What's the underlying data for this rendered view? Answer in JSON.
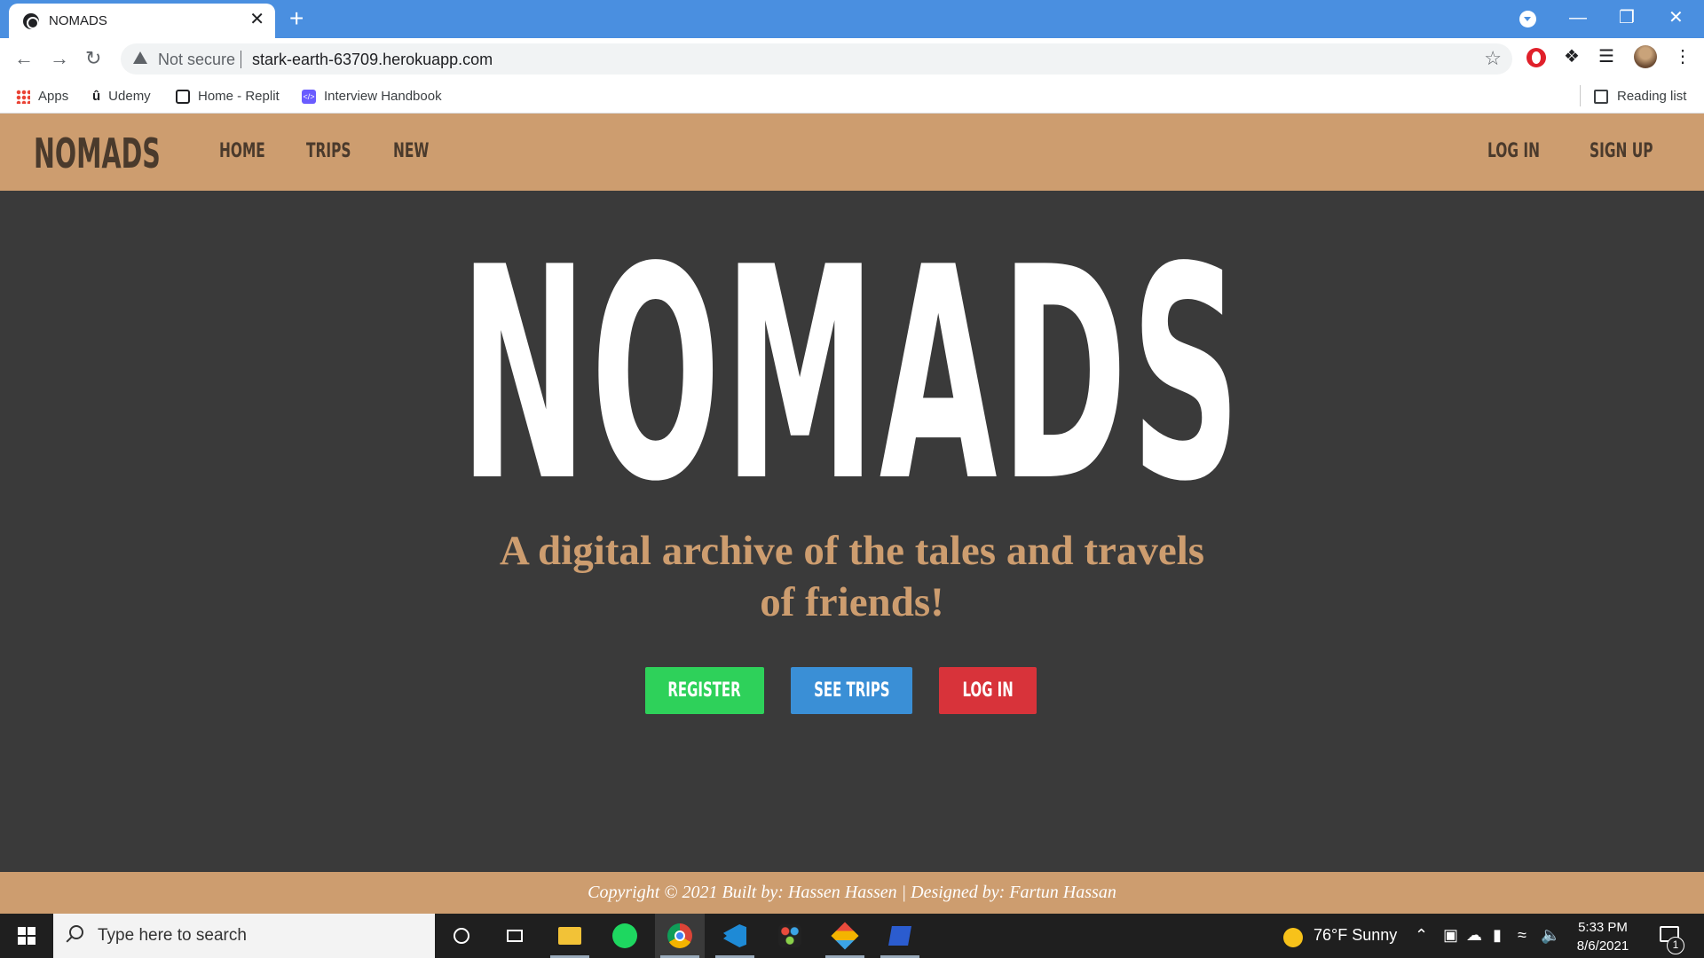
{
  "browser": {
    "tab_title": "NOMADS",
    "tab_close": "✕",
    "new_tab": "+",
    "security_label": "Not secure",
    "url": "stark-earth-63709.herokuapp.com",
    "window_controls": [
      "—",
      "❐",
      "✕"
    ],
    "icons": [
      "globe-icon",
      "back-arrow-icon",
      "forward-arrow-icon",
      "reload-icon",
      "warning-icon",
      "star-icon",
      "opera-icon",
      "puzzle-icon",
      "media-icon",
      "profile-avatar",
      "menu-dots-icon"
    ]
  },
  "bookmarks": {
    "items": [
      {
        "label": "Apps"
      },
      {
        "label": "Udemy"
      },
      {
        "label": "Home - Replit"
      },
      {
        "label": "Interview Handbook"
      }
    ],
    "reading_list": "Reading list"
  },
  "site": {
    "brand": "NOMADS",
    "nav": [
      {
        "label": "HOME"
      },
      {
        "label": "TRIPS"
      },
      {
        "label": "NEW"
      }
    ],
    "auth": [
      {
        "label": "LOG IN"
      },
      {
        "label": "SIGN UP"
      }
    ],
    "hero_title": "NOMADS",
    "tagline": "A digital archive of the tales and travels of friends!",
    "buttons": {
      "register": "REGISTER",
      "see_trips": "SEE TRIPS",
      "log_in": "LOG IN"
    },
    "footer": "Copyright © 2021 Built by: Hassen Hassen | Designed by: Fartun Hassan",
    "colors": {
      "accent_tan": "#cd9d6f",
      "background": "#3a3a3a",
      "register": "#2ed15a",
      "see_trips": "#3a8fd6",
      "log_in": "#d8333a"
    }
  },
  "taskbar": {
    "search_placeholder": "Type here to search",
    "weather": "76°F  Sunny",
    "time": "5:33 PM",
    "date": "8/6/2021",
    "notification_count": "1"
  }
}
